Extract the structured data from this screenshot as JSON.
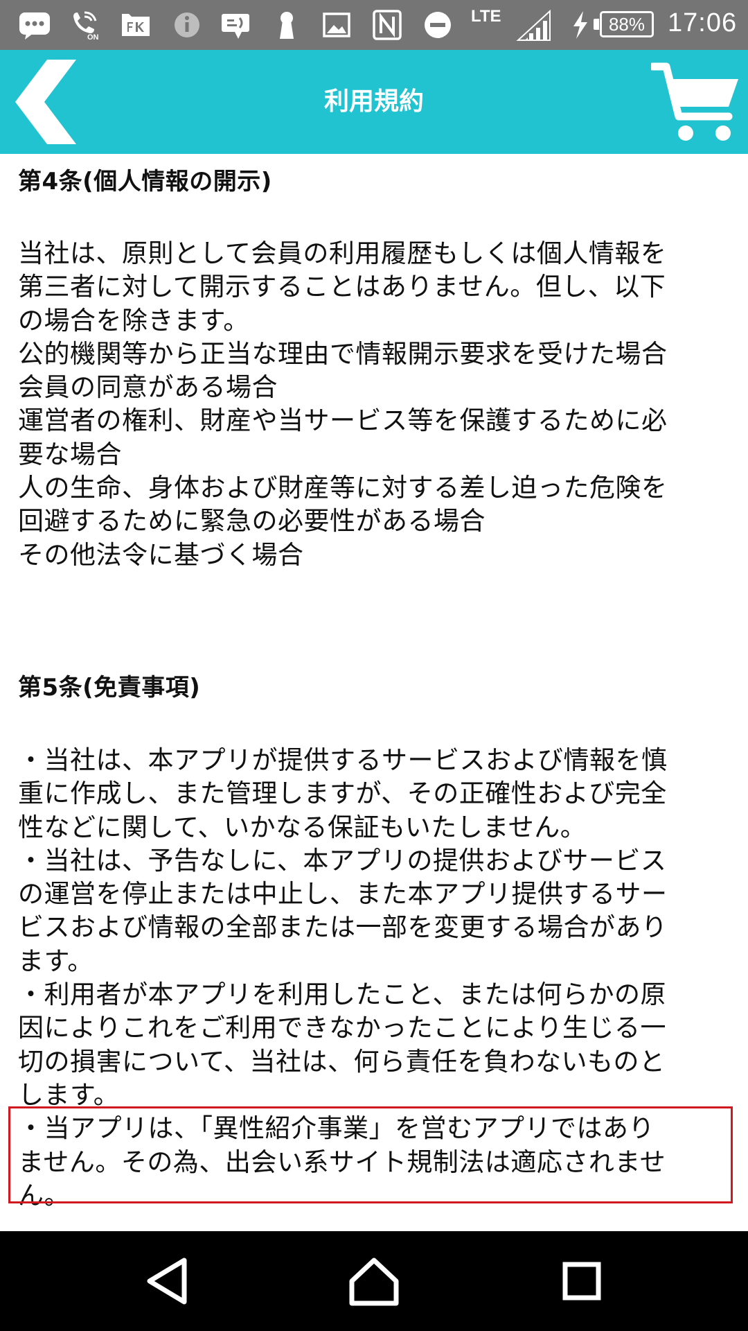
{
  "status_bar": {
    "network_label": "LTE",
    "battery_percent": "88%",
    "battery_level": 0.88,
    "time": "17:06",
    "icons": [
      "message-icon",
      "wifi-calling-icon",
      "app-notification-icon",
      "info-icon",
      "feedback-icon",
      "keyhole-icon",
      "image-icon",
      "nfc-icon",
      "do-not-disturb-icon",
      "signal-icon",
      "charging-icon",
      "battery-icon"
    ]
  },
  "app_bar": {
    "title": "利用規約",
    "back_icon": "chevron-left-icon",
    "cart_icon": "cart-icon",
    "color": "#22c3d0"
  },
  "content": {
    "section4": {
      "heading": "第4条(個人情報の開示)",
      "lines": [
        "当社は、原則として会員の利用履歴もしくは個人情報を",
        "第三者に対して開示することはありません。但し、以下",
        "の場合を除きます。",
        "公的機関等から正当な理由で情報開示要求を受けた場合",
        "会員の同意がある場合",
        "運営者の権利、財産や当サービス等を保護するために必",
        "要な場合",
        "人の生命、身体および財産等に対する差し迫った危険を",
        "回避するために緊急の必要性がある場合",
        "その他法令に基づく場合"
      ]
    },
    "section5": {
      "heading": "第5条(免責事項)",
      "lines": [
        "・当社は、本アプリが提供するサービスおよび情報を慎",
        "重に作成し、また管理しますが、その正確性および完全",
        "性などに関して、いかなる保証もいたしません。",
        "・当社は、予告なしに、本アプリの提供およびサービス",
        "の運営を停止または中止し、また本アプリ提供するサー",
        "ビスおよび情報の全部または一部を変更する場合があり",
        "ます。",
        "・利用者が本アプリを利用したこと、または何らかの原",
        "因によりこれをご利用できなかったことにより生じる一",
        "切の損害について、当社は、何ら責任を負わないものと",
        "します。",
        "・当アプリは、「異性紹介事業」を営むアプリではあり",
        "ません。その為、出会い系サイト規制法は適応されませ",
        "ん。"
      ]
    },
    "highlight_color": "#d01820"
  },
  "nav_bar": {
    "icons": [
      "nav-back-icon",
      "nav-home-icon",
      "nav-recents-icon"
    ]
  }
}
